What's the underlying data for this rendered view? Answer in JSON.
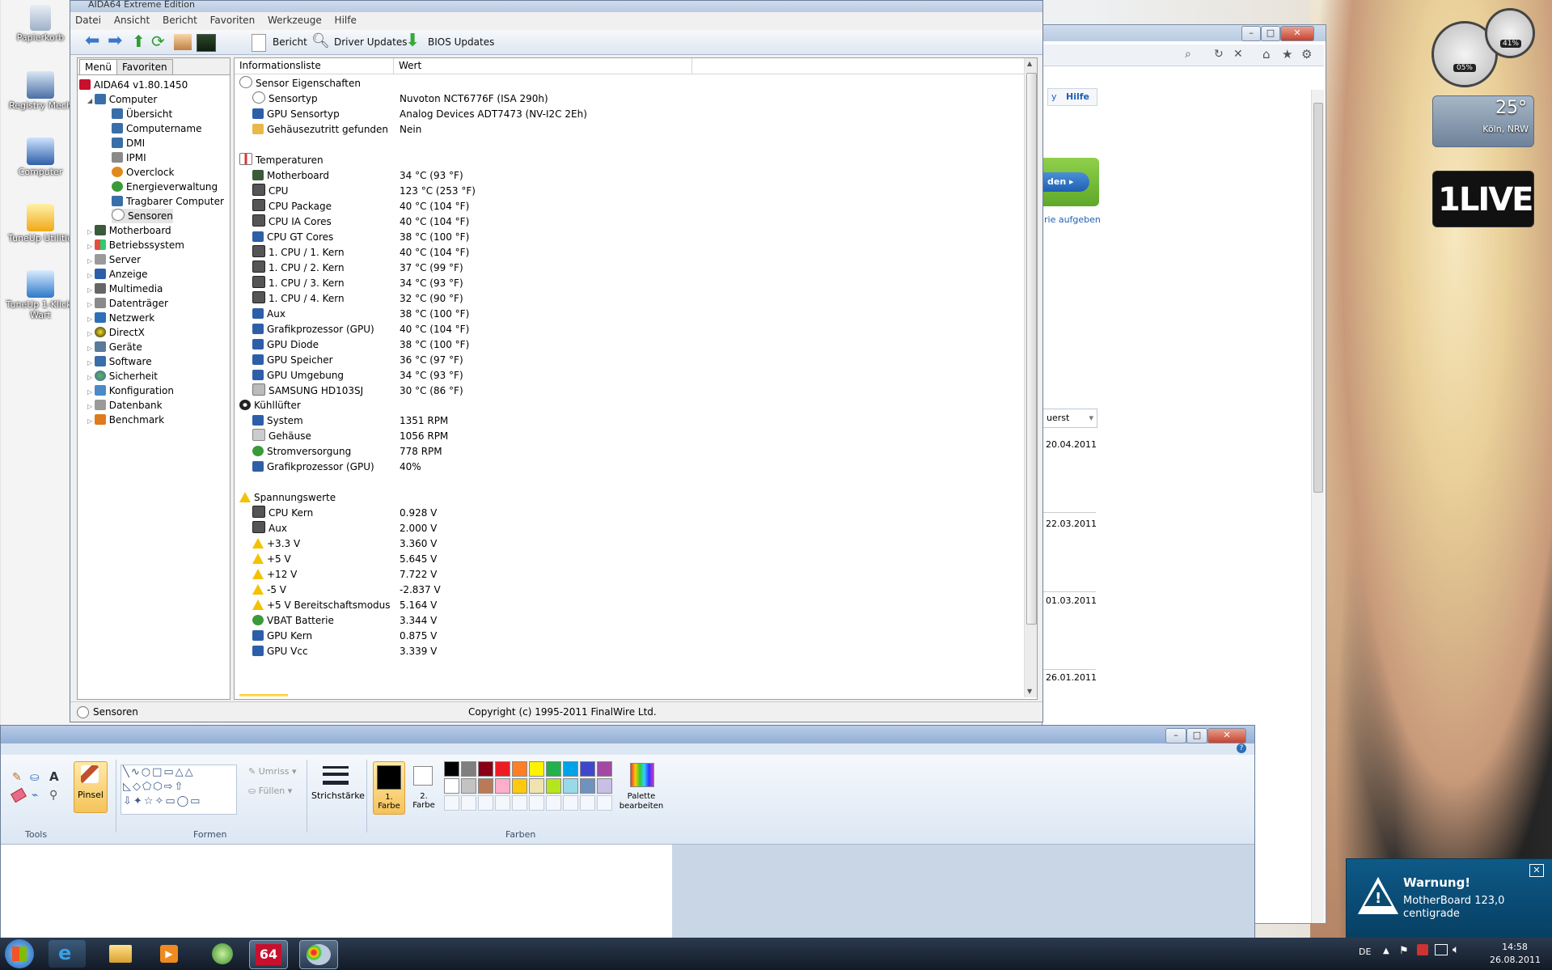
{
  "desktop": {
    "icons": [
      {
        "label": "Papierkorb"
      },
      {
        "label": "Registry Mech"
      },
      {
        "label": "Computer"
      },
      {
        "label": "TuneUp Utilitie"
      },
      {
        "label": "TuneUp 1-Klick-Wart"
      }
    ]
  },
  "gadgets": {
    "meter_left": "05%",
    "meter_right": "41%",
    "weather_temp": "25°",
    "weather_location": "Köln, NRW",
    "radio_logo": "1LIVE"
  },
  "aida": {
    "title": "AIDA64 Extreme Edition",
    "menu": [
      "Datei",
      "Ansicht",
      "Bericht",
      "Favoriten",
      "Werkzeuge",
      "Hilfe"
    ],
    "toolbar": {
      "report": "Bericht",
      "driver_updates": "Driver Updates",
      "bios_updates": "BIOS Updates"
    },
    "tabs": {
      "menu": "Menü",
      "favorites": "Favoriten"
    },
    "tree": {
      "root": "AIDA64 v1.80.1450",
      "computer": "Computer",
      "computer_children": [
        "Übersicht",
        "Computername",
        "DMI",
        "IPMI",
        "Overclock",
        "Energieverwaltung",
        "Tragbarer Computer",
        "Sensoren"
      ],
      "top": [
        "Motherboard",
        "Betriebssystem",
        "Server",
        "Anzeige",
        "Multimedia",
        "Datenträger",
        "Netzwerk",
        "DirectX",
        "Geräte",
        "Software",
        "Sicherheit",
        "Konfiguration",
        "Datenbank",
        "Benchmark"
      ]
    },
    "columns": {
      "name": "Informationsliste",
      "value": "Wert"
    },
    "sections": [
      {
        "title": "Sensor Eigenschaften",
        "rows": [
          {
            "name": "Sensortyp",
            "value": "Nuvoton NCT6776F  (ISA 290h)"
          },
          {
            "name": "GPU Sensortyp",
            "value": "Analog Devices ADT7473  (NV-I2C 2Eh)"
          },
          {
            "name": "Gehäusezutritt gefunden",
            "value": "Nein"
          }
        ]
      },
      {
        "title": "Temperaturen",
        "rows": [
          {
            "name": "Motherboard",
            "value": "34 °C  (93 °F)"
          },
          {
            "name": "CPU",
            "value": "123 °C  (253 °F)"
          },
          {
            "name": "CPU Package",
            "value": "40 °C  (104 °F)"
          },
          {
            "name": "CPU IA Cores",
            "value": "40 °C  (104 °F)"
          },
          {
            "name": "CPU GT Cores",
            "value": "38 °C  (100 °F)"
          },
          {
            "name": "1. CPU / 1. Kern",
            "value": "40 °C  (104 °F)"
          },
          {
            "name": "1. CPU / 2. Kern",
            "value": "37 °C  (99 °F)"
          },
          {
            "name": "1. CPU / 3. Kern",
            "value": "34 °C  (93 °F)"
          },
          {
            "name": "1. CPU / 4. Kern",
            "value": "32 °C  (90 °F)"
          },
          {
            "name": "Aux",
            "value": "38 °C  (100 °F)"
          },
          {
            "name": "Grafikprozessor (GPU)",
            "value": "40 °C  (104 °F)"
          },
          {
            "name": "GPU Diode",
            "value": "38 °C  (100 °F)"
          },
          {
            "name": "GPU Speicher",
            "value": "36 °C  (97 °F)"
          },
          {
            "name": "GPU Umgebung",
            "value": "34 °C  (93 °F)"
          },
          {
            "name": "SAMSUNG HD103SJ",
            "value": "30 °C  (86 °F)"
          }
        ]
      },
      {
        "title": "Kühllüfter",
        "rows": [
          {
            "name": "System",
            "value": "1351 RPM"
          },
          {
            "name": "Gehäuse",
            "value": "1056 RPM"
          },
          {
            "name": "Stromversorgung",
            "value": "778 RPM"
          },
          {
            "name": "Grafikprozessor (GPU)",
            "value": "40%"
          }
        ]
      },
      {
        "title": "Spannungswerte",
        "rows": [
          {
            "name": "CPU Kern",
            "value": "0.928 V"
          },
          {
            "name": "Aux",
            "value": "2.000 V"
          },
          {
            "name": "+3.3 V",
            "value": "3.360 V"
          },
          {
            "name": "+5 V",
            "value": "5.645 V"
          },
          {
            "name": "+12 V",
            "value": "7.722 V"
          },
          {
            "name": "-5 V",
            "value": "-2.837 V"
          },
          {
            "name": "+5 V Bereitschaftsmodus",
            "value": "5.164 V"
          },
          {
            "name": "VBAT Batterie",
            "value": "3.344 V"
          },
          {
            "name": "GPU Kern",
            "value": "0.875 V"
          },
          {
            "name": "GPU Vcc",
            "value": "3.339 V"
          }
        ]
      }
    ],
    "status": {
      "left": "Sensoren",
      "center": "Copyright (c) 1995-2011 FinalWire Ltd."
    }
  },
  "browser": {
    "help_link": "Hilfe",
    "nav_prefix": "y",
    "green_button": "den",
    "side_link": "rie aufgeben",
    "sort_label": "uerst",
    "dates": [
      "20.04.2011",
      "22.03.2011",
      "01.03.2011",
      "26.01.2011"
    ]
  },
  "paint": {
    "tools_label": "Tools",
    "brush_label": "Pinsel",
    "shapes_label": "Formen",
    "outline_label": "Umriss",
    "fill_label": "Füllen",
    "stroke_label": "Strichstärke",
    "color1_label": "1. Farbe",
    "color2_label": "2. Farbe",
    "colors_label": "Farben",
    "palette_label": "Palette bearbeiten",
    "swatches_row1": [
      "#000000",
      "#7f7f7f",
      "#880015",
      "#ed1c24",
      "#ff7f27",
      "#fff200",
      "#22b14c",
      "#00a2e8",
      "#3f48cc",
      "#a349a4"
    ],
    "swatches_row2": [
      "#ffffff",
      "#c3c3c3",
      "#b97a57",
      "#ffaec9",
      "#ffc90e",
      "#efe4b0",
      "#b5e61d",
      "#99d9ea",
      "#7092be",
      "#c8bfe7"
    ]
  },
  "toast": {
    "title": "Warnung!",
    "message": "MotherBoard 123,0 centigrade"
  },
  "tray": {
    "lang": "DE",
    "time": "14:58",
    "date": "26.08.2011"
  }
}
